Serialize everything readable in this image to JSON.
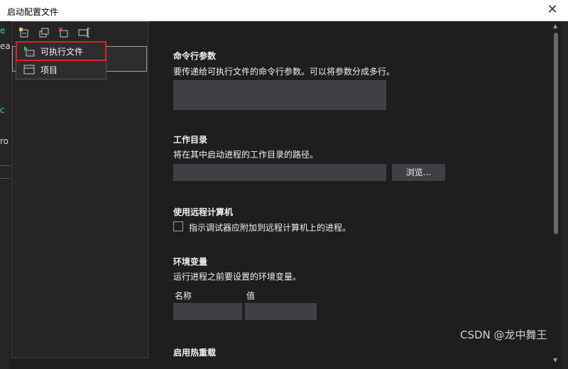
{
  "window": {
    "title": "启动配置文件",
    "close_glyph": "✕"
  },
  "background_fragments": [
    "e",
    "ea",
    "c",
    "ro"
  ],
  "toolbar": {
    "icons": [
      "new-profile-icon",
      "copy-profile-icon",
      "delete-profile-icon",
      "rename-profile-icon"
    ]
  },
  "menu": {
    "items": [
      {
        "label": "可执行文件",
        "icon": "executable-icon"
      },
      {
        "label": "项目",
        "icon": "project-icon"
      }
    ]
  },
  "sections": {
    "cmd": {
      "title": "命令行参数",
      "desc": "要传递给可执行文件的命令行参数。可以将参数分成多行。"
    },
    "workdir": {
      "title": "工作目录",
      "desc": "将在其中启动进程的工作目录的路径。",
      "browse_label": "浏览..."
    },
    "remote": {
      "title": "使用远程计算机",
      "checkbox_label": "指示调试器应附加到远程计算机上的进程。"
    },
    "env": {
      "title": "环境变量",
      "desc": "运行进程之前要设置的环境变量。",
      "col_name": "名称",
      "col_value": "值"
    },
    "hotreload": {
      "title": "启用热重载"
    }
  },
  "watermark": "CSDN @龙中舞王",
  "colors": {
    "highlight_border": "#e02020",
    "background": "#1e1e1e",
    "input": "#3f3f46"
  }
}
